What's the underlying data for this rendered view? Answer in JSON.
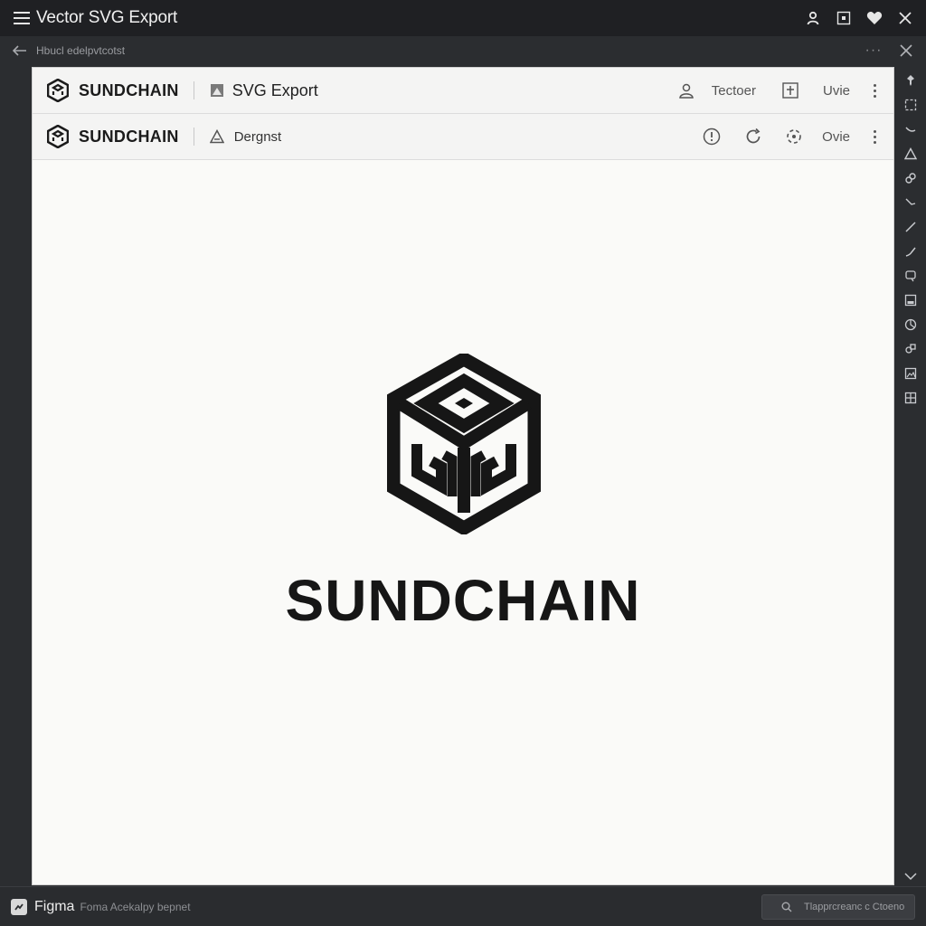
{
  "window": {
    "title": "Vector SVG Export",
    "path": "Hbucl edelpvtcotst"
  },
  "toolbar_primary": {
    "brand": "SUNDCHAIN",
    "file_label": "SVG Export",
    "user_label": "Tectoer",
    "action_label": "Uvie"
  },
  "toolbar_secondary": {
    "brand": "SUNDCHAIN",
    "file_label": "Dergnst",
    "action_label": "Ovie"
  },
  "canvas": {
    "logo_wordmark": "SUNDCHAIN"
  },
  "statusbar": {
    "app_name": "Figma",
    "status_text": "Foma Acekalpy bepnet",
    "search_placeholder": "Tlapprcreanc c Ctoeno"
  },
  "colors": {
    "chrome_dark": "#1f2023",
    "panel_bg": "#2b2d30",
    "canvas_bg": "#fafaf8",
    "logo_ink": "#161616"
  }
}
